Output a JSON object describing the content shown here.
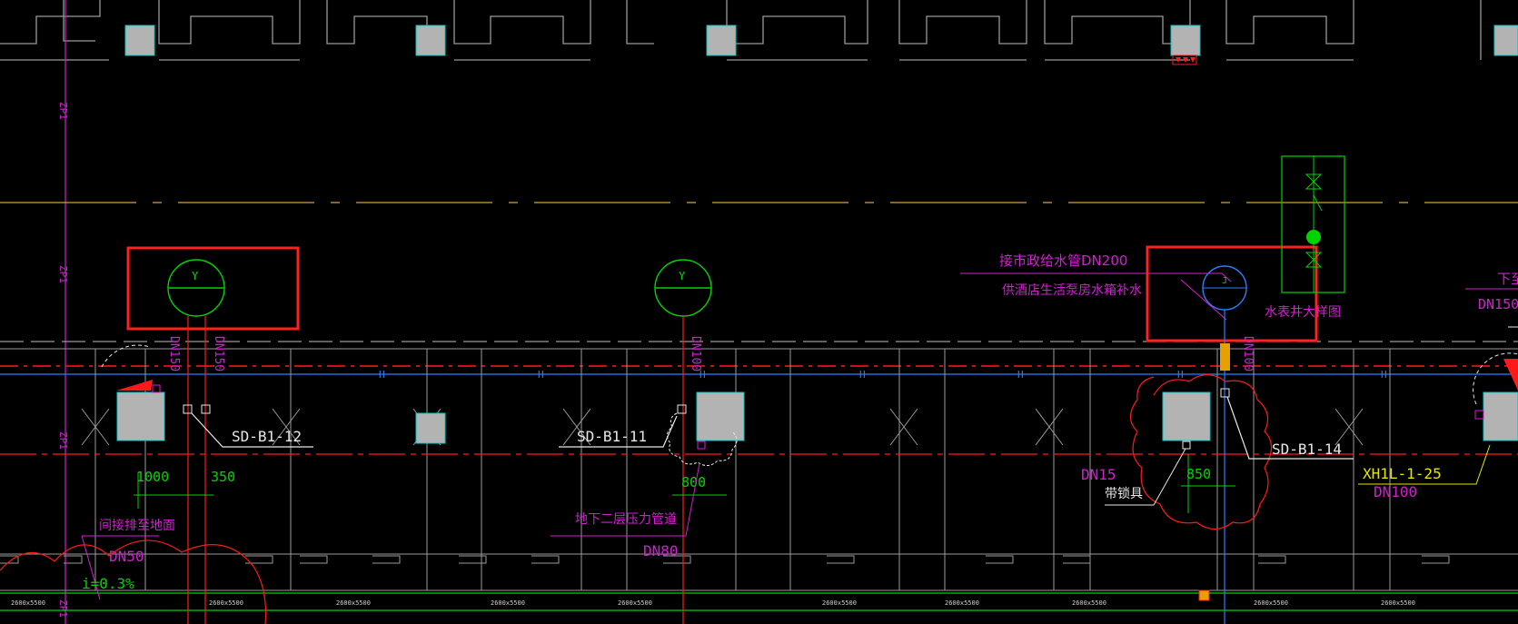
{
  "colors": {
    "background": "#000000",
    "wall": "#9a9a9a",
    "column_fill": "#b3b3b3",
    "column_edge": "#00c8c8",
    "magenta": "#d21fd2",
    "green": "#00d400",
    "red": "#ff1a1a",
    "blue": "#2a7fff",
    "white": "#e8e8e8",
    "yellow": "#e6e600",
    "orange": "#d2a040",
    "highlight_box": "#ff2020"
  },
  "drawing": {
    "pipe_mark_zp1": "ZP1",
    "pipe_mark_h": "H",
    "symbol_y": "Y",
    "symbol_j": "J",
    "labels": {
      "sd12": "SD-B1-12",
      "sd11": "SD-B1-11",
      "sd14": "SD-B1-14",
      "dn150_v": "DN150",
      "dn150_v2": "DN150",
      "dn100_v": "DN100",
      "dn100_v2": "DN100",
      "dim_1000": "1000",
      "dim_350": "350",
      "dim_800": "800",
      "dim_850": "850",
      "indirect": "间接排至地面",
      "dn50": "DN50",
      "slope": "i=0.3%",
      "b2_pressure": "地下二层压力管道",
      "dn80": "DN80",
      "city_supply": "接市政给水管DN200",
      "hotel_tank": "供酒店生活泵房水箱补水",
      "meter_well": "水表井大样图",
      "dn15": "DN15",
      "with_lock": "带锁具",
      "xh1l": "XH1L-1-25",
      "dn100": "DN100",
      "right_top_1": "下至",
      "right_top_2": "DN150"
    },
    "grid_label": "2600x5500",
    "grid_label_2": "2600x5500"
  }
}
